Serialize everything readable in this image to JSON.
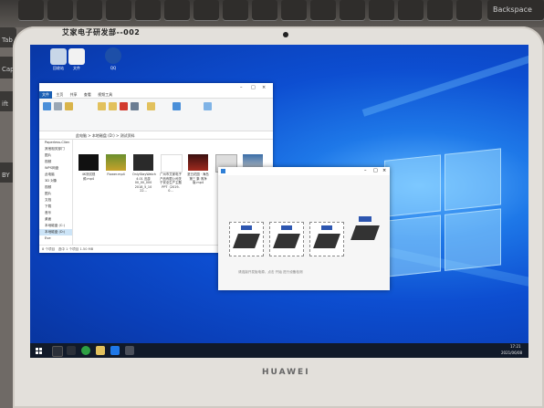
{
  "keyboard": {
    "backspace_label": "Backspace",
    "tab_label": "Tab",
    "caps_label": "CapsL",
    "shift_label": "ift",
    "by_label": "BY"
  },
  "tablet": {
    "sticker_label": "艾家电子研发部--002",
    "brand": "HUAWEI"
  },
  "explorer": {
    "ribbon_tabs": [
      "文件",
      "主页",
      "共享",
      "查看",
      "视频工具"
    ],
    "address_path": "此电脑 > 本地磁盘 (D:) > 测试资料",
    "nav_items": [
      "Paperless-Clien",
      "其他相关部门",
      "图片",
      "视频",
      "WPS网盘",
      "此电脑",
      "3D 对象",
      "视频",
      "图片",
      "文档",
      "下载",
      "音乐",
      "桌面",
      "本地磁盘 (C:)",
      "本地磁盘 (D:)",
      "Eve"
    ],
    "files": [
      {
        "name": "4K测试视频.mp4"
      },
      {
        "name": "Flower.mp4"
      },
      {
        "name": "OnlyStayWatch 4.01 迅游 00_00_000 2018_5_10 22..."
      },
      {
        "name": "广州市艾家电子产品有限公司关于安全生产主题 PPT（2019-0..."
      },
      {
        "name": "夏日花园 · 海岛 第三 集 清净版.mp4"
      },
      {
        "name": ""
      }
    ],
    "status": "8 个项目　选中 1 个项目 1.50 MB"
  },
  "dialog": {
    "footer": "请连接开发板电源，点击 开始 进行设备检测"
  },
  "taskbar": {
    "time": "17:21",
    "date": "2021/06/08"
  },
  "desktop_icons": [
    "回收站",
    "文件",
    "QQ"
  ]
}
